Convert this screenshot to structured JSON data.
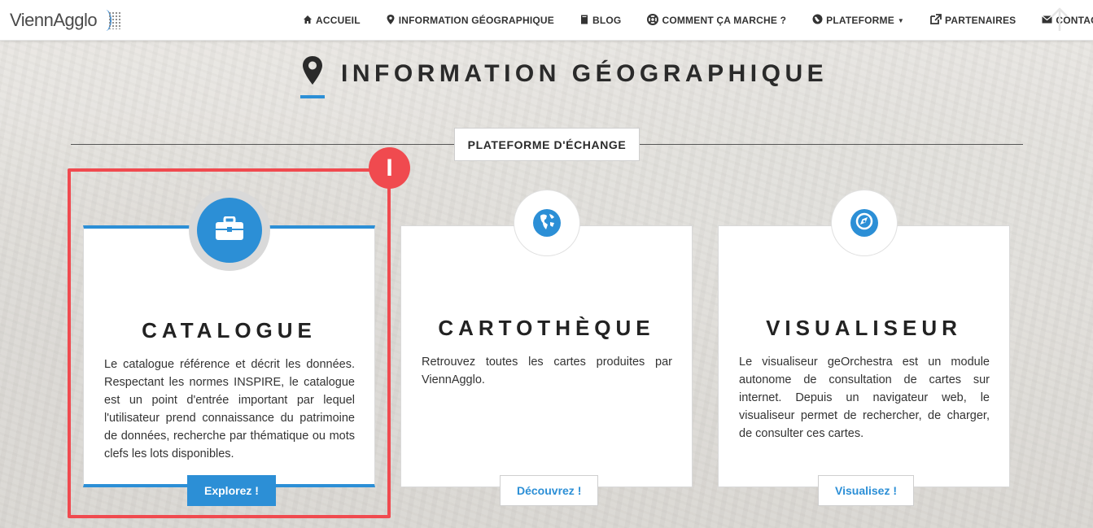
{
  "navbar": {
    "brand": "ViennAgglo",
    "items": [
      {
        "icon": "home-icon",
        "label": "Accueil"
      },
      {
        "icon": "map-marker-icon",
        "label": "Information géographique"
      },
      {
        "icon": "book-icon",
        "label": "Blog"
      },
      {
        "icon": "lifebuoy-icon",
        "label": "Comment ça marche ?"
      },
      {
        "icon": "globe-icon",
        "label": "Plateforme",
        "dropdown": true
      },
      {
        "icon": "external-link-icon",
        "label": "Partenaires"
      },
      {
        "icon": "envelope-icon",
        "label": "Contact"
      }
    ]
  },
  "page": {
    "title": "Information géographique",
    "section_label": "Plateforme d'échange"
  },
  "cards": [
    {
      "icon": "briefcase-icon",
      "title": "Catalogue",
      "description": "Le catalogue référence et décrit les données. Respectant les normes INSPIRE, le catalogue est un point d'entrée important par lequel l'utilisateur prend connaissance du patrimoine de données, recherche par thématique ou mots clefs les lots disponibles.",
      "button": "Explorez !"
    },
    {
      "icon": "globe-americas-icon",
      "title": "Cartothèque",
      "description": "Retrouvez toutes les cartes produites par ViennAgglo.",
      "button": "Découvrez !"
    },
    {
      "icon": "compass-icon",
      "title": "Visualiseur",
      "description": "Le visualiseur geOrchestra est un module autonome de consultation de cartes sur internet. Depuis un navigateur web, le visualiseur permet de rechercher, de charger, de consulter ces cartes.",
      "button": "Visualisez !"
    }
  ],
  "annotation": {
    "badge": "I",
    "color": "#f04a4f"
  },
  "colors": {
    "accent": "#2c8fd6"
  }
}
